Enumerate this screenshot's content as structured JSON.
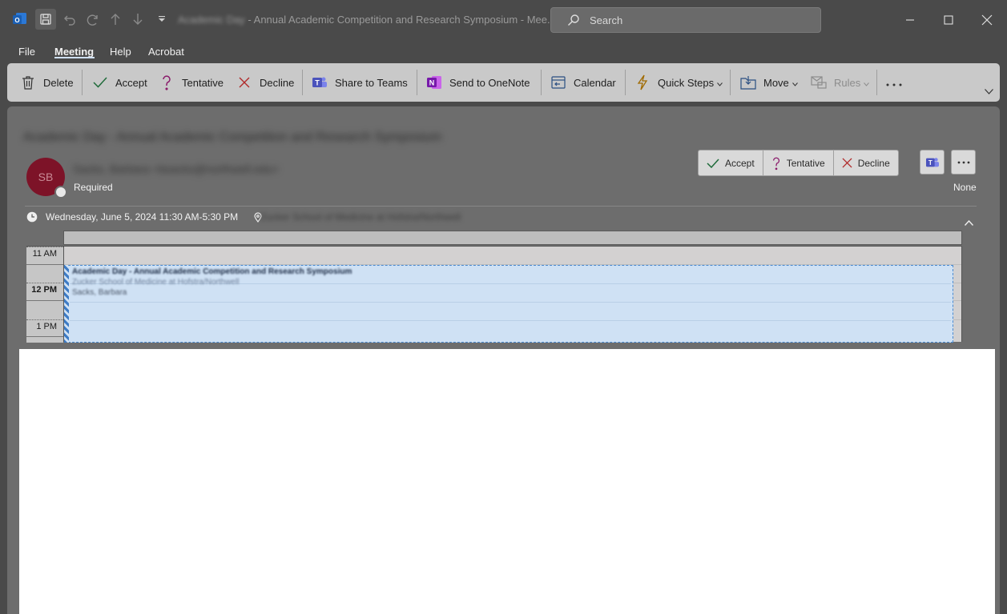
{
  "titlebar": {
    "title_blurred": "Academic Day",
    "title_rest": " - Annual Academic Competition and Research Symposium  -  Mee...",
    "search_placeholder": "Search"
  },
  "menu": [
    "File",
    "Meeting",
    "Help",
    "Acrobat"
  ],
  "ribbon": {
    "delete": "Delete",
    "accept": "Accept",
    "tentative": "Tentative",
    "decline": "Decline",
    "share_teams": "Share to Teams",
    "send_onenote": "Send to OneNote",
    "calendar": "Calendar",
    "quick_steps": "Quick Steps",
    "move": "Move",
    "rules": "Rules"
  },
  "meeting": {
    "subject": "Academic Day - Annual Academic Competition and Research Symposium",
    "organizer": "Sacks, Barbara <bsacks@northwell.edu>",
    "avatar_initials": "SB",
    "required_label": "Required",
    "response_status": "None",
    "datetime": "Wednesday, June 5, 2024 11:30 AM-5:30 PM",
    "location": "Zucker School of Medicine at Hofstra/Northwell",
    "rsvp": {
      "accept": "Accept",
      "tentative": "Tentative",
      "decline": "Decline"
    }
  },
  "calendar": {
    "hours": [
      "11 AM",
      "12 PM",
      "1 PM"
    ],
    "event": {
      "title": "Academic Day - Annual Academic Competition and Research Symposium",
      "location": "Zucker School of Medicine at Hofstra/Northwell",
      "organizer": "Sacks, Barbara"
    }
  },
  "colors": {
    "ribbon_bg": "#c9c9c9",
    "event_fill": "#cfe1f4",
    "event_border": "#4a8ad0",
    "avatar": "#7d1328"
  }
}
